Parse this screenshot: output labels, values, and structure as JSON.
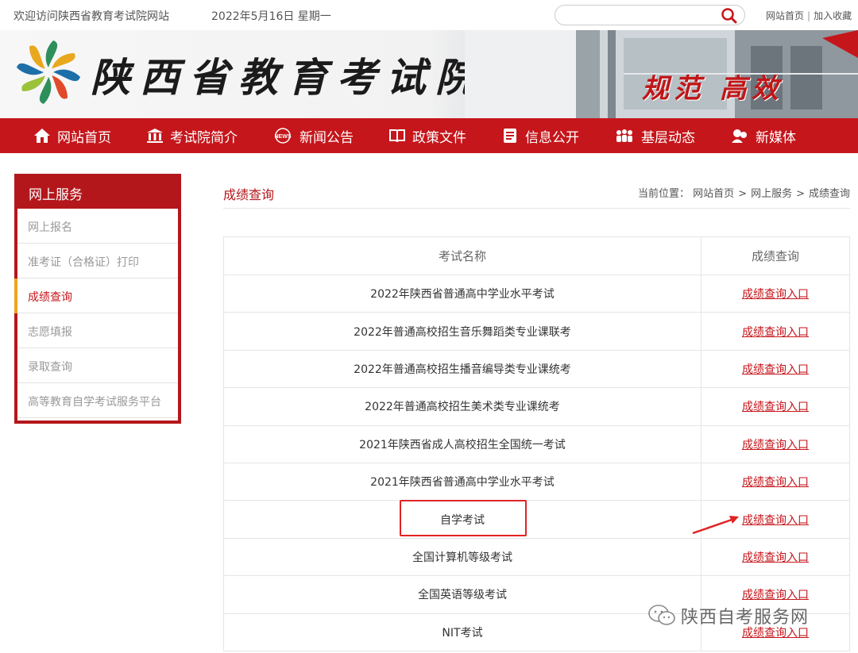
{
  "topbar": {
    "welcome": "欢迎访问陕西省教育考试院网站",
    "date": "2022年5月16日 星期一",
    "search_placeholder": "",
    "links": [
      "网站首页",
      "加入收藏"
    ]
  },
  "banner": {
    "title": "陕西省教育考试院",
    "slogan": "规范 高效"
  },
  "nav": [
    {
      "label": "网站首页",
      "icon": "home-icon"
    },
    {
      "label": "考试院简介",
      "icon": "building-icon"
    },
    {
      "label": "新闻公告",
      "icon": "news-icon"
    },
    {
      "label": "政策文件",
      "icon": "book-icon"
    },
    {
      "label": "信息公开",
      "icon": "document-icon"
    },
    {
      "label": "基层动态",
      "icon": "people-icon"
    },
    {
      "label": "新媒体",
      "icon": "media-icon"
    }
  ],
  "sidebar": {
    "title": "网上服务",
    "items": [
      "网上报名",
      "准考证（合格证）打印",
      "成绩查询",
      "志愿填报",
      "录取查询",
      "高等教育自学考试服务平台"
    ],
    "active_index": 2
  },
  "main": {
    "current_title": "成绩查询",
    "breadcrumb_prefix": "当前位置：",
    "breadcrumb": [
      "网站首页",
      "网上服务",
      "成绩查询"
    ]
  },
  "table": {
    "headers": [
      "考试名称",
      "成绩查询"
    ],
    "link_text": "成绩查询入口",
    "rows": [
      "2022年陕西省普通高中学业水平考试",
      "2022年普通高校招生音乐舞蹈类专业课联考",
      "2022年普通高校招生播音编导类专业课统考",
      "2022年普通高校招生美术类专业课统考",
      "2021年陕西省成人高校招生全国统一考试",
      "2021年陕西省普通高中学业水平考试",
      "自学考试",
      "全国计算机等级考试",
      "全国英语等级考试",
      "NIT考试"
    ]
  },
  "watermark": "陕西自考服务网",
  "colors": {
    "brand_red": "#c5161b",
    "dark_red": "#b4171b",
    "accent_orange": "#f0a21e"
  }
}
